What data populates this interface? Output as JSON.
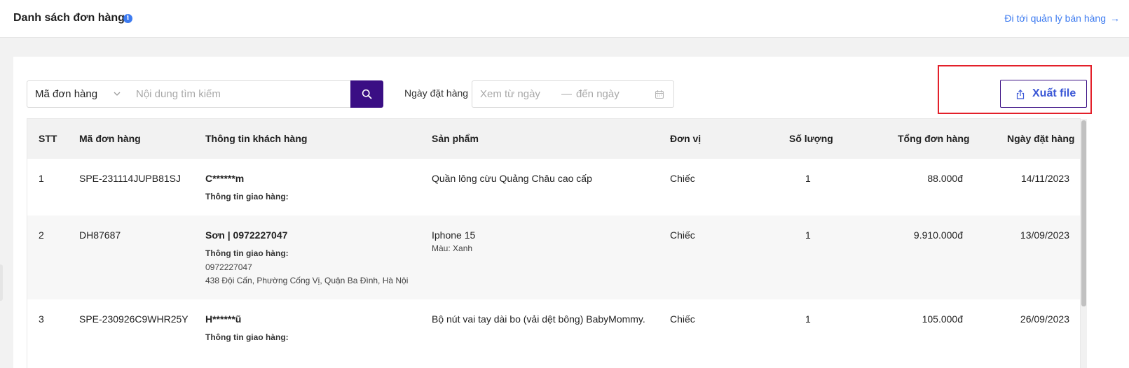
{
  "header": {
    "title": "Danh sách đơn hàng",
    "info_icon_glyph": "i",
    "goto_link": "Đi tới quản lý bán hàng",
    "goto_arrow": "→"
  },
  "filters": {
    "field_select": "Mã đơn hàng",
    "search_placeholder": "Nội dung tìm kiếm",
    "date_label": "Ngày đặt hàng",
    "date_from_placeholder": "Xem từ ngày",
    "date_separator": "—",
    "date_to_placeholder": "đến ngày"
  },
  "toolbar": {
    "export_label": "Xuất file"
  },
  "table": {
    "columns": [
      "STT",
      "Mã đơn hàng",
      "Thông tin khách hàng",
      "Sản phẩm",
      "Đơn vị",
      "Số lượng",
      "Tổng đơn hàng",
      "Ngày đặt hàng"
    ],
    "rows": [
      {
        "stt": "1",
        "order_id": "SPE-231114JUPB81SJ",
        "customer_name": "C******m",
        "shipping_label": "Thông tin giao hàng:",
        "phone": "",
        "address": "",
        "product": "Quần lông cừu Quảng Châu cao cấp",
        "variant": "",
        "unit": "Chiếc",
        "quantity": "1",
        "total": "88.000đ",
        "date": "14/11/2023"
      },
      {
        "stt": "2",
        "order_id": "DH87687",
        "customer_name": "Sơn | 0972227047",
        "shipping_label": "Thông tin giao hàng:",
        "phone": "0972227047",
        "address": "438 Đội Cấn, Phường Cống Vị, Quận Ba Đình, Hà Nội",
        "product": "Iphone 15",
        "variant": "Màu: Xanh",
        "unit": "Chiếc",
        "quantity": "1",
        "total": "9.910.000đ",
        "date": "13/09/2023"
      },
      {
        "stt": "3",
        "order_id": "SPE-230926C9WHR25Y",
        "customer_name": "H******ũ",
        "shipping_label": "Thông tin giao hàng:",
        "phone": "",
        "address": "",
        "product": "Bộ nút vai tay dài bo (vải dệt bông) BabyMommy.",
        "variant": "",
        "unit": "Chiếc",
        "quantity": "1",
        "total": "105.000đ",
        "date": "26/09/2023"
      }
    ]
  },
  "icons": {
    "info": "info-icon",
    "select_chevron": "chevron-down-icon",
    "search": "search-icon",
    "calendar": "calendar-icon",
    "export": "upload-icon"
  },
  "colors": {
    "primary": "#3a0e84",
    "link": "#3d7bf0",
    "export_text": "#3a57d6",
    "highlight": "#e3202a"
  }
}
